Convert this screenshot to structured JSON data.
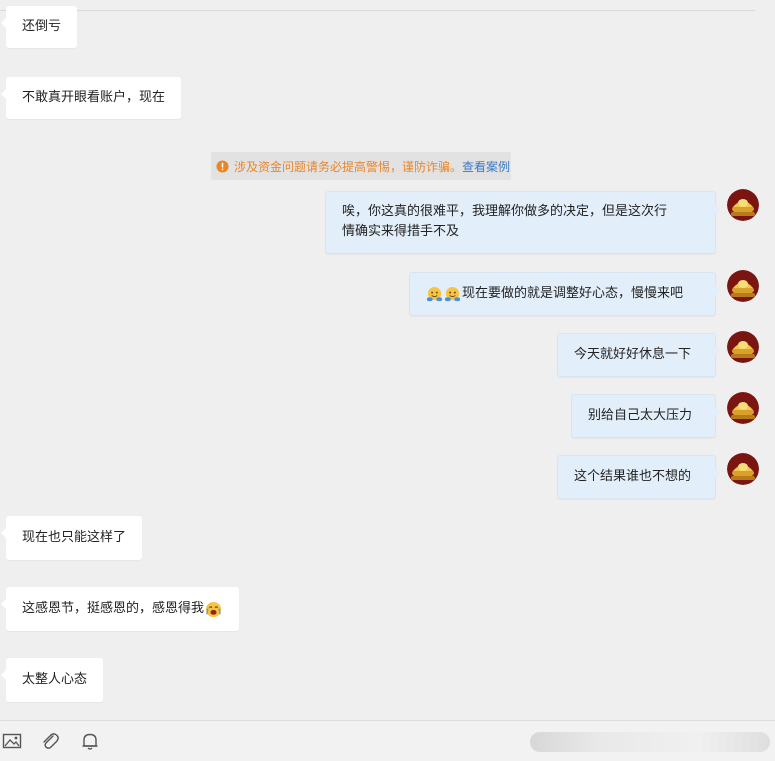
{
  "messages": [
    {
      "text": "还倒亏"
    },
    {
      "text": "不敢真开眼看账户，现在"
    },
    {
      "text": "唉，你这真的很难平，我理解你做多的决定，但是这次行",
      "text2": "情确实来得措手不及"
    },
    {
      "text": "现在要做的就是调整好心态，慢慢来吧",
      "emoji": "hug-emoji"
    },
    {
      "text": "今天就好好休息一下"
    },
    {
      "text": "别给自己太大压力"
    },
    {
      "text": "这个结果谁也不想的"
    },
    {
      "text": "现在也只能这样了"
    },
    {
      "text": "这感恩节，挺感恩的，感恩得我",
      "emoji": "crying-emoji"
    },
    {
      "text": "太整人心态"
    }
  ],
  "notice": {
    "text": "涉及资金问题请务必提高警惕，谨防诈骗。",
    "link": "查看案例",
    "icon": "info-icon",
    "color": "#e8862a",
    "link_color": "#3b79c6"
  },
  "toolbar": {
    "icons": [
      "image-icon",
      "attachment-icon",
      "bell-icon"
    ]
  },
  "colors": {
    "background": "#efefef",
    "incoming_bubble": "#ffffff",
    "outgoing_bubble": "#e2eef9"
  }
}
